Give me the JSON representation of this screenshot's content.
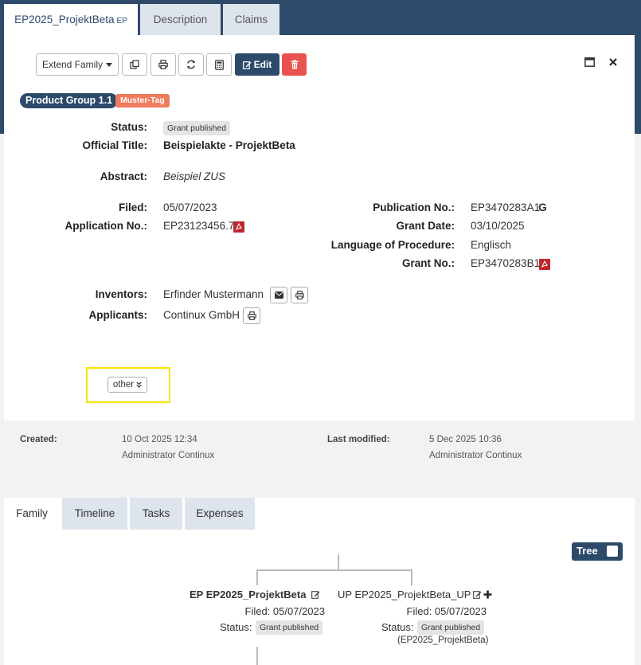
{
  "tabs": {
    "main": "EP2025_ProjektBeta",
    "main_suffix": "EP",
    "description": "Description",
    "claims": "Claims"
  },
  "toolbar": {
    "extend_family": "Extend Family",
    "edit": "Edit"
  },
  "tags": {
    "product_group": "Product Group 1.1",
    "muster": "Muster-Tag"
  },
  "fields": {
    "status_label": "Status:",
    "status_value": "Grant published",
    "official_title_label": "Official Title:",
    "official_title_value": "Beispielakte - ProjektBeta",
    "abstract_label": "Abstract:",
    "abstract_value": "Beispiel ZUS",
    "filed_label": "Filed:",
    "filed_value": "05/07/2023",
    "application_no_label": "Application No.:",
    "application_no_value": "EP23123456.7",
    "publication_no_label": "Publication No.:",
    "publication_no_value": "EP3470283A1",
    "google_glyph": "G",
    "grant_date_label": "Grant Date:",
    "grant_date_value": "03/10/2025",
    "language_label": "Language of Procedure:",
    "language_value": "Englisch",
    "grant_no_label": "Grant No.:",
    "grant_no_value": "EP3470283B1",
    "inventors_label": "Inventors:",
    "inventors_value": "Erfinder Mustermann",
    "applicants_label": "Applicants:",
    "applicants_value": "Continux GmbH"
  },
  "other_button": "other",
  "meta": {
    "created_label": "Created:",
    "created_date": "10 Oct 2025 12:34",
    "created_by": "Administrator Continux",
    "modified_label": "Last modified:",
    "modified_date": "5 Dec 2025 10:36",
    "modified_by": "Administrator Continux"
  },
  "bottom_tabs": {
    "family": "Family",
    "timeline": "Timeline",
    "tasks": "Tasks",
    "expenses": "Expenses"
  },
  "tree_toggle": "Tree",
  "family_nodes": [
    {
      "prefix": "EP",
      "title": "EP2025_ProjektBeta",
      "filed": "Filed: 05/07/2023",
      "status_label": "Status:",
      "status_value": "Grant published"
    },
    {
      "prefix": "UP",
      "title": "EP2025_ProjektBeta_UP",
      "filed": "Filed: 05/07/2023",
      "status_label": "Status:",
      "status_value": "Grant published",
      "parent_ref": "(EP2025_ProjektBeta)"
    }
  ],
  "colors": {
    "header_navy": "#2d4a6a",
    "danger_red": "#e8534f",
    "tag_salmon": "#ef7c5d",
    "highlight_yellow": "#f5e400",
    "pdf_red": "#c0262d"
  },
  "icons": {
    "copy": "copy-icon",
    "print": "print-icon",
    "refresh": "refresh-icon",
    "calculator": "calculator-icon",
    "edit": "edit-icon",
    "trash": "trash-icon",
    "maximize": "maximize-icon",
    "close": "close-icon",
    "envelope": "envelope-icon",
    "pdf": "pdf-icon",
    "google": "google-icon",
    "chevron_double_down": "chevron-double-down-icon",
    "plus": "plus-icon"
  }
}
